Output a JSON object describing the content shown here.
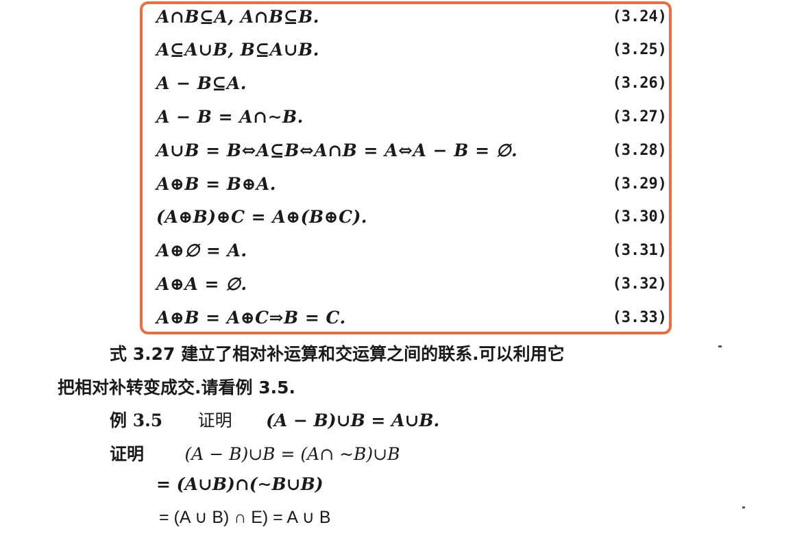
{
  "equations": [
    {
      "formula": "A∩B⊆A, A∩B⊆B.",
      "number": "(3.24)"
    },
    {
      "formula": "A⊆A∪B, B⊆A∪B.",
      "number": "(3.25)"
    },
    {
      "formula": "A − B⊆A.",
      "number": "(3.26)"
    },
    {
      "formula": "A − B = A∩∼B.",
      "number": "(3.27)"
    },
    {
      "formula": "A∪B = B⇔A⊆B⇔A∩B = A⇔A − B = ∅.",
      "number": "(3.28)"
    },
    {
      "formula": "A⊕B = B⊕A.",
      "number": "(3.29)"
    },
    {
      "formula": "(A⊕B)⊕C = A⊕(B⊕C).",
      "number": "(3.30)"
    },
    {
      "formula": "A⊕∅ = A.",
      "number": "(3.31)"
    },
    {
      "formula": "A⊕A = ∅.",
      "number": "(3.32)"
    },
    {
      "formula": "A⊕B = A⊕C⇒B = C.",
      "number": "(3.33)"
    }
  ],
  "paragraph": {
    "line1": "式 3.27 建立了相对补运算和交运算之间的联系.可以利用它",
    "line2": "把相对补转变成交.请看例 3.5."
  },
  "example": {
    "label": "例 3.5",
    "verb": "证明",
    "statement": "(A − B)∪B = A∪B."
  },
  "proof": {
    "label": "证明",
    "step1": "(A − B)∪B = (A∩ ∼B)∪B",
    "step2": "= (A∪B)∩(∼B∪B)",
    "step3": "= (A ∪ B) ∩ E)    = A ∪ B"
  }
}
